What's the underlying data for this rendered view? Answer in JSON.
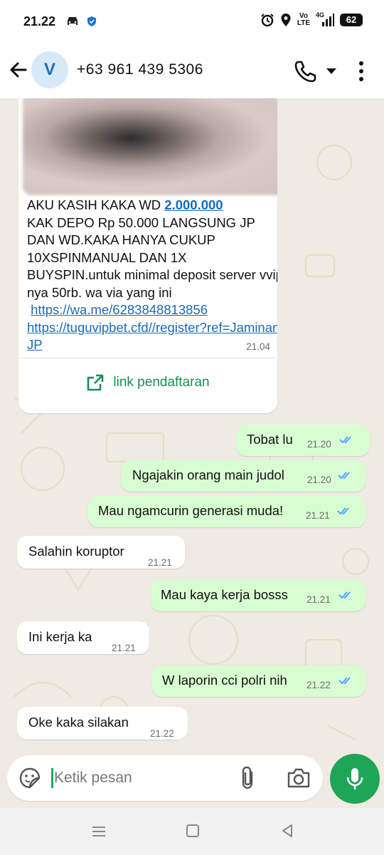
{
  "status_bar": {
    "time": "21.22",
    "volte_top": "Vo",
    "volte_bottom": "LTE",
    "network": "4G",
    "battery": "62"
  },
  "header": {
    "avatar_letter": "V",
    "contact": "+63 961 439 5306"
  },
  "card": {
    "line1_prefix": "AKU KASIH KAKA WD ",
    "line1_link": "2.000.000",
    "body_text": "KAK DEPO Rp 50.000 LANGSUNG JP DAN WD.KAKA HANYA CUKUP 10XSPINMANUAL DAN 1X BUYSPIN.untuk minimal deposit server vvip nya 50rb. wa via yang ini",
    "link1": "https://wa.me/6283848813856",
    "link2": "https://tuguvipbet.cfd//register?ref=JaminanJP",
    "time": "21.04",
    "action_label": "link pendaftaran"
  },
  "messages": [
    {
      "dir": "out",
      "text": "Tobat lu",
      "time": "21.20"
    },
    {
      "dir": "out",
      "text": "Ngajakin orang main judol",
      "time": "21.20"
    },
    {
      "dir": "out",
      "text": "Mau ngamcurin generasi muda!",
      "time": "21.21"
    },
    {
      "dir": "in",
      "text": "Salahin koruptor",
      "time": "21.21"
    },
    {
      "dir": "out",
      "text": "Mau kaya kerja bosss",
      "time": "21.21"
    },
    {
      "dir": "in",
      "text": "Ini kerja ka",
      "time": "21.21"
    },
    {
      "dir": "out",
      "text": "W laporin cci polri nih",
      "time": "21.22"
    },
    {
      "dir": "in",
      "text": "Oke kaka silakan",
      "time": "21.22"
    }
  ],
  "input": {
    "placeholder": "Ketik pesan"
  },
  "colors": {
    "outgoing_bubble": "#d9fdd3",
    "incoming_bubble": "#ffffff",
    "chat_background": "#efeae2",
    "accent_green": "#1ea556",
    "read_ticks": "#53a6fd"
  },
  "icons": [
    "back-arrow-icon",
    "call-icon",
    "chevron-down-icon",
    "more-vertical-icon",
    "open-link-icon",
    "double-check-icon",
    "emoji-sticker-icon",
    "paperclip-icon",
    "camera-icon",
    "mic-icon"
  ]
}
